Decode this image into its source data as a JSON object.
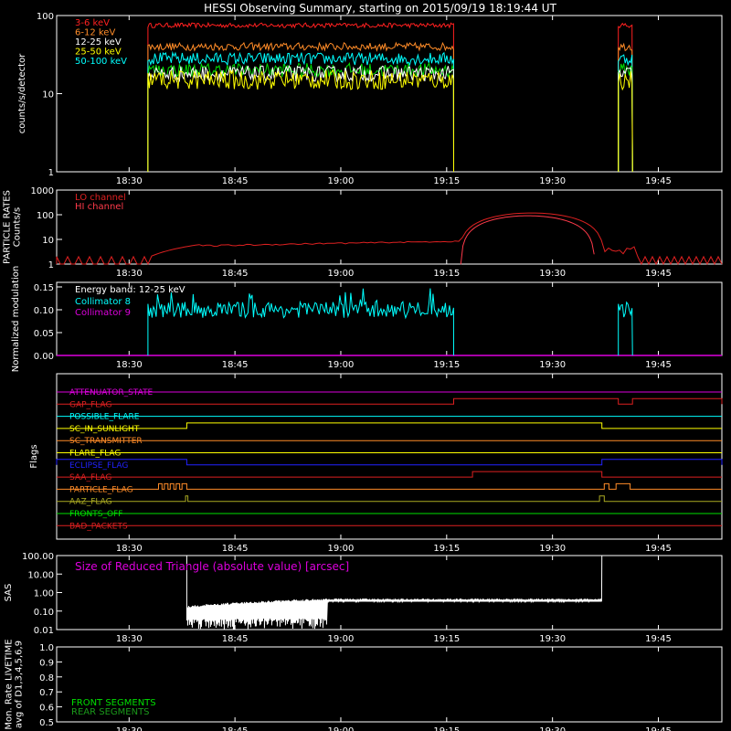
{
  "title": "HESSI Observing Summary, starting on 2015/09/19 18:19:44 UT",
  "time_ticks": [
    "18:30",
    "18:45",
    "19:00",
    "19:15",
    "19:30",
    "19:45"
  ],
  "colors": {
    "bg": "#000000",
    "axis": "#ffffff",
    "red": "#ff2020",
    "orange": "#ff8c28",
    "white": "#ffffff",
    "yellow": "#ffff00",
    "green": "#00e000",
    "cyan": "#00ffff",
    "crimson": "#ff3a4a",
    "magenta": "#dd00dd",
    "blue": "#2222ff",
    "olive": "#aaaa22",
    "darkgreen": "#1a9a1a",
    "darkred": "#dd2020"
  },
  "chart_data": [
    {
      "type": "line",
      "id": "count-rates",
      "ylabel": "counts/s/detector",
      "yscale": "log",
      "ylim": [
        1,
        100
      ],
      "yticks": [
        "1",
        "10",
        "100"
      ],
      "xlim": [
        "18:19:44",
        "19:54:00"
      ],
      "legend_placement": "top-left",
      "series": [
        {
          "name": "3-6 keV",
          "color": "#ff2020",
          "level": 75,
          "spread": 0.06
        },
        {
          "name": "6-12 keV",
          "color": "#ff8c28",
          "level": 40,
          "spread": 0.1
        },
        {
          "name": "12-25 keV",
          "color": "#ffffff",
          "level": 18,
          "spread": 0.2
        },
        {
          "name": "25-50 keV",
          "color": "#ffff00",
          "level": 15,
          "spread": 0.25
        },
        {
          "name": "50-100 keV",
          "color": "#00ffff",
          "level": 28,
          "spread": 0.16
        }
      ],
      "green_series": {
        "color": "#00e000",
        "level": 20,
        "spread": 0.18
      },
      "segments": [
        [
          "18:32:40",
          "19:16:00"
        ],
        [
          "19:39:20",
          "19:41:20"
        ]
      ]
    },
    {
      "type": "line",
      "id": "particle-rates",
      "ylabel": "PARTICLE RATES Counts/s",
      "yscale": "log",
      "ylim": [
        1,
        1000
      ],
      "yticks": [
        "1",
        "10",
        "100",
        "1000"
      ],
      "legend_placement": "top-left",
      "series": [
        {
          "name": "LO channel",
          "color": "#dd2020"
        },
        {
          "name": "HI channel",
          "color": "#ff3a4a"
        }
      ]
    },
    {
      "type": "line",
      "id": "modulation",
      "ylabel": "Normalized modulation",
      "ylim": [
        0,
        0.16
      ],
      "yticks": [
        "0.00",
        "0.05",
        "0.10",
        "0.15"
      ],
      "legend_placement": "top-left",
      "annotation": "Energy band: 12-25 keV",
      "series": [
        {
          "name": "Collimator 8",
          "color": "#00ffff",
          "level": 0.1
        },
        {
          "name": "Collimator 9",
          "color": "#dd00dd",
          "level": 0.0
        }
      ],
      "segments": [
        [
          "18:32:40",
          "19:16:00"
        ],
        [
          "19:39:20",
          "19:41:20"
        ]
      ]
    },
    {
      "type": "table",
      "id": "flags",
      "ylabel": "Flags",
      "flags": [
        {
          "name": "ATTENUATOR_STATE",
          "color": "#dd00dd",
          "changes": []
        },
        {
          "name": "GAP_FLAG",
          "color": "#dd2020",
          "changes": [
            [
              "19:16:00",
              "19:39:20"
            ],
            [
              "19:41:20",
              "19:54:00"
            ]
          ]
        },
        {
          "name": "POSSIBLE_FLARE",
          "color": "#00ffff",
          "changes": []
        },
        {
          "name": "SC_IN_SUNLIGHT",
          "color": "#ffff00",
          "changes": [
            [
              "18:38:10",
              "19:37:00"
            ]
          ]
        },
        {
          "name": "SC_TRANSMITTER",
          "color": "#ff8c28",
          "changes": []
        },
        {
          "name": "FLARE_FLAG",
          "color": "#ffff00",
          "changes": []
        },
        {
          "name": "ECLIPSE_FLAG",
          "color": "#2222ff",
          "changes": [
            [
              "18:19:44",
              "18:38:10"
            ],
            [
              "19:37:00",
              "19:54:00"
            ]
          ]
        },
        {
          "name": "SAA_FLAG",
          "color": "#dd2020",
          "changes": [
            [
              "19:18:40",
              "19:37:00"
            ]
          ]
        },
        {
          "name": "PARTICLE_FLAG",
          "color": "#ff8c28",
          "changes": [
            [
              "18:34:10",
              "18:34:40"
            ],
            [
              "18:35:00",
              "18:35:30"
            ],
            [
              "18:35:50",
              "18:36:20"
            ],
            [
              "18:36:40",
              "18:37:10"
            ],
            [
              "18:37:30",
              "18:38:10"
            ],
            [
              "19:37:20",
              "19:38:00"
            ],
            [
              "19:39:00",
              "19:41:00"
            ]
          ]
        },
        {
          "name": "AAZ_FLAG",
          "color": "#aaaa22",
          "changes": [
            [
              "18:38:00",
              "18:38:20"
            ],
            [
              "19:36:40",
              "19:37:20"
            ]
          ]
        },
        {
          "name": "FRONTS_OFF",
          "color": "#00e000",
          "changes": []
        },
        {
          "name": "BAD_PACKETS",
          "color": "#dd2020",
          "changes": []
        }
      ]
    },
    {
      "type": "line",
      "id": "sas",
      "ylabel": "SAS",
      "yscale": "log",
      "ylim": [
        0.01,
        100
      ],
      "yticks": [
        "0.01",
        "0.10",
        "1.00",
        "10.00",
        "100.00"
      ],
      "annotation": "Size of Reduced Triangle (absolute value) [arcsec]",
      "annotation_color": "#dd00dd",
      "series": [
        {
          "name": "",
          "color": "#ffffff"
        }
      ]
    },
    {
      "type": "line",
      "id": "livetime",
      "ylabel": "Mon. Rate LIVETIME avg of D1,3,4,5,6,9",
      "ylim": [
        0.5,
        1.0
      ],
      "yticks": [
        "0.5",
        "0.6",
        "0.7",
        "0.8",
        "0.9",
        "1.0"
      ],
      "series": [
        {
          "name": "FRONT SEGMENTS",
          "color": "#00e000"
        },
        {
          "name": "REAR SEGMENTS",
          "color": "#1a9a1a"
        }
      ]
    }
  ]
}
